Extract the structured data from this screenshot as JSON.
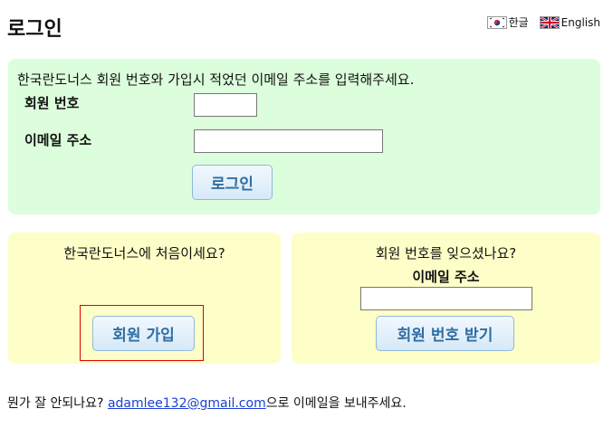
{
  "header": {
    "title": "로그인"
  },
  "languages": [
    {
      "label": "한글",
      "icon": "korea-flag-icon"
    },
    {
      "label": "English",
      "icon": "uk-flag-icon"
    }
  ],
  "login": {
    "instruction": "한국란도너스 회원 번호와 가입시 적었던 이메일 주소를 입력해주세요.",
    "member_number_label": "회원 번호",
    "member_number_value": "",
    "email_label": "이메일 주소",
    "email_value": "",
    "submit_label": "로그인"
  },
  "signup": {
    "question": "한국란도너스에 처음이세요?",
    "button_label": "회원 가입"
  },
  "forgot": {
    "question": "회원 번호를 잊으셨나요?",
    "email_label": "이메일 주소",
    "email_value": "",
    "button_label": "회원 번호 받기"
  },
  "footer": {
    "prefix": "뭔가 잘 안되나요? ",
    "email_link": "adamlee132@gmail.com",
    "suffix": "으로 이메일을 보내주세요."
  },
  "colors": {
    "login_panel_bg": "#dcfedc",
    "info_panel_bg": "#fefec8",
    "button_text": "#2f6ea3",
    "highlight_border": "#e00000"
  }
}
